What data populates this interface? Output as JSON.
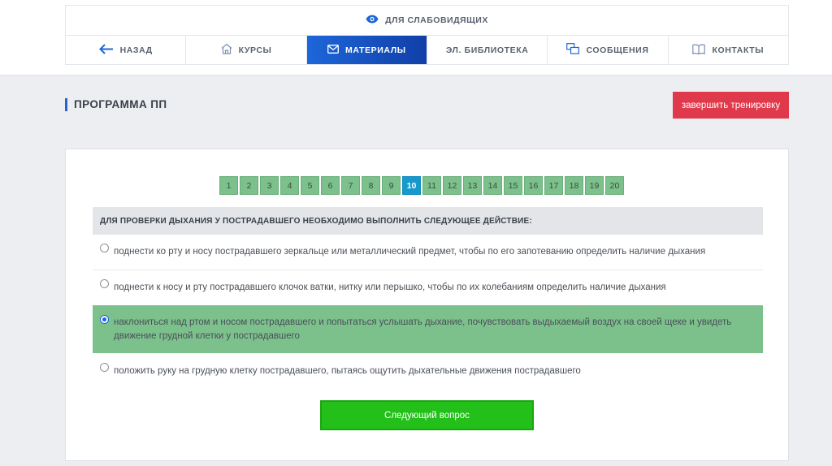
{
  "header": {
    "lowvision_label": "ДЛЯ СЛАБОВИДЯЩИХ",
    "nav": [
      {
        "label": "НАЗАД",
        "icon": "arrow-left-icon"
      },
      {
        "label": "КУРСЫ",
        "icon": "house-icon"
      },
      {
        "label": "МАТЕРИАЛЫ",
        "icon": "envelope-icon",
        "active": true
      },
      {
        "label": "ЭЛ. БИБЛИОТЕКА",
        "icon": ""
      },
      {
        "label": "СООБЩЕНИЯ",
        "icon": "messages-icon"
      },
      {
        "label": "КОНТАКТЫ",
        "icon": "book-icon"
      }
    ]
  },
  "page": {
    "title": "ПРОГРАММА ПП",
    "finish_label": "завершить тренировку"
  },
  "pager": {
    "pages": [
      "1",
      "2",
      "3",
      "4",
      "5",
      "6",
      "7",
      "8",
      "9",
      "10",
      "11",
      "12",
      "13",
      "14",
      "15",
      "16",
      "17",
      "18",
      "19",
      "20"
    ],
    "current": "10"
  },
  "question": {
    "text": "ДЛЯ ПРОВЕРКИ ДЫХАНИЯ У ПОСТРАДАВШЕГО НЕОБХОДИМО ВЫПОЛНИТЬ СЛЕДУЮЩЕЕ ДЕЙСТВИЕ:",
    "answers": [
      {
        "text": "поднести ко рту и носу пострадавшего зеркальце или металлический предмет, чтобы по его запотеванию определить наличие дыхания",
        "selected": false
      },
      {
        "text": "поднести к носу и рту пострадавшего клочок ватки, нитку или перышко, чтобы по их колебаниям определить наличие дыхания",
        "selected": false
      },
      {
        "text": "наклониться над ртом и носом пострадавшего и попытаться услышать дыхание, почувствовать выдыхаемый воздух на своей щеке и увидеть движение грудной клетки у пострадавшего",
        "selected": true
      },
      {
        "text": "положить руку на грудную клетку пострадавшего, пытаясь ощутить дыхательные движения пострадавшего",
        "selected": false
      }
    ],
    "next_label": "Следующий вопрос"
  },
  "colors": {
    "accent_blue": "#1d66d9",
    "finish_red": "#e0394b",
    "page_green": "#7cc08c",
    "current_page": "#159ad0",
    "next_green": "#23c01a"
  }
}
